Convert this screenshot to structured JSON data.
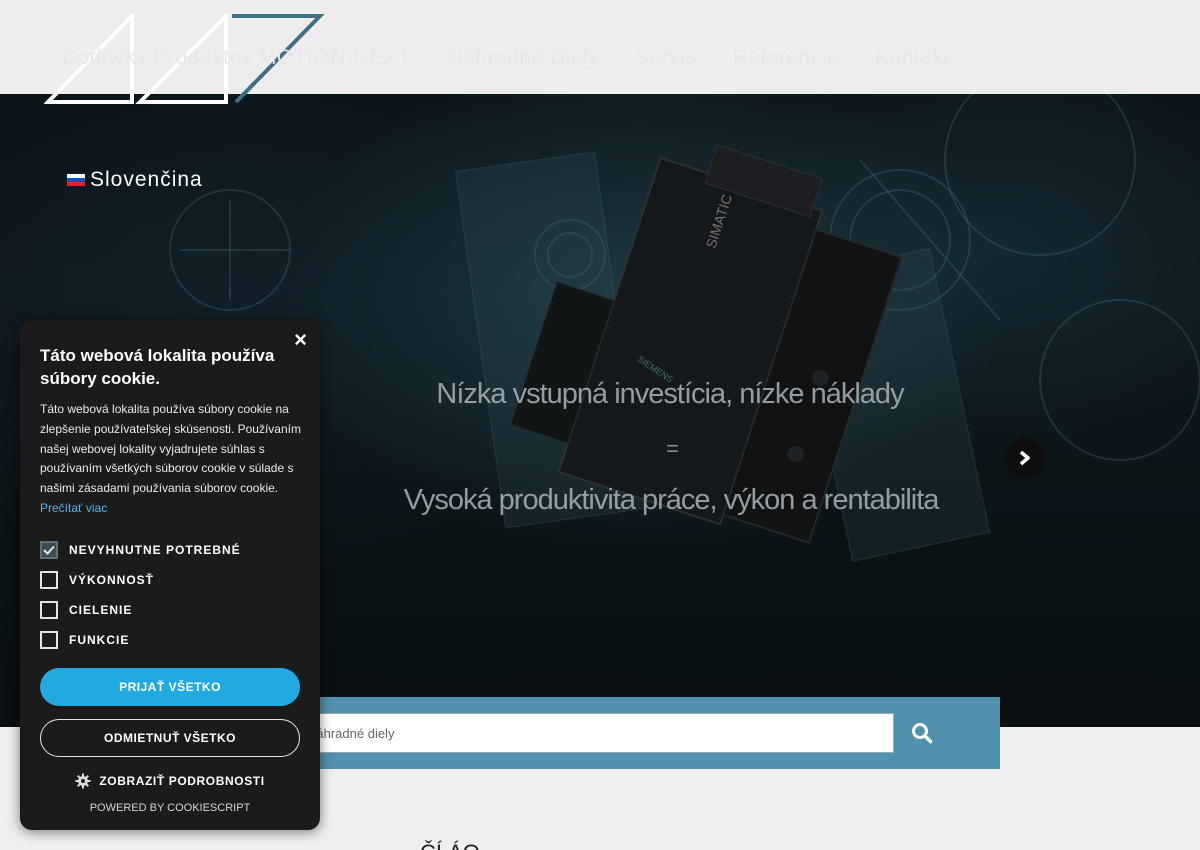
{
  "nav": {
    "items": [
      "Dodávky Produktov MOTION-NEXT",
      "Náhradné Diely",
      "Servis",
      "Referencie",
      "Kontakt"
    ]
  },
  "language": {
    "label": "Slovenčina"
  },
  "hero": {
    "line1": "Nízka vstupná investícia, nízke náklady",
    "eq": "=",
    "line2": "Vysoká produktivita práce, výkon a rentabilita",
    "product_text": "SIMATIC",
    "product_brand": "SIEMENS"
  },
  "search": {
    "placeholder": "Náhradné diely"
  },
  "bottom": {
    "heading": "ČÍ    ÁO"
  },
  "cookie": {
    "close": "×",
    "title": "Táto webová lokalita používa súbory cookie.",
    "text": "Táto webová lokalita používa súbory cookie na zlepšenie používateľskej skúsenosti. Používaním našej webovej lokality vyjadrujete súhlas s používaním všetkých súborov cookie v súlade s našimi zásadami používania súborov cookie.",
    "read_more": "Prečítať viac",
    "options": [
      {
        "label": "NEVYHNUTNE POTREBNÉ",
        "checked": true
      },
      {
        "label": "VÝKONNOSŤ",
        "checked": false
      },
      {
        "label": "CIELENIE",
        "checked": false
      },
      {
        "label": "FUNKCIE",
        "checked": false
      }
    ],
    "accept": "PRIJAŤ VŠETKO",
    "reject": "ODMIETNUŤ VŠETKO",
    "details": "ZOBRAZIŤ PODROBNOSTI",
    "powered": "POWERED BY COOKIESCRIPT"
  },
  "colors": {
    "search_bar": "#5191ad",
    "accept_button": "#21a9e1",
    "logo_accent": "#3f6f86"
  }
}
